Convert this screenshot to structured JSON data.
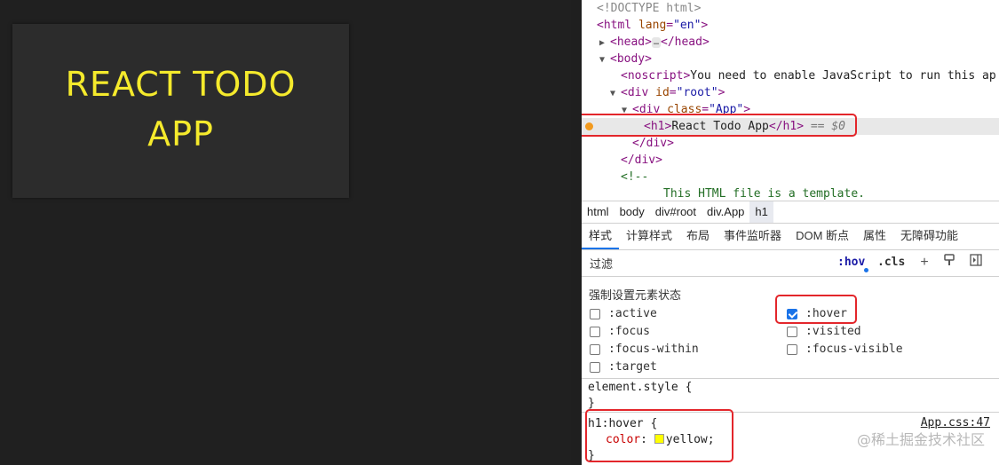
{
  "app": {
    "title": "REACT TODO APP"
  },
  "dom_tree": {
    "doctype": "<!DOCTYPE html>",
    "html_open_tag": "html",
    "html_attr_name": "lang",
    "html_attr_value": "\"en\"",
    "head_tag": "head",
    "head_close": "</head>",
    "body_tag": "body",
    "noscript_tag": "noscript",
    "noscript_text": "You need to enable JavaScript to run this ap",
    "div_root_tag": "div",
    "div_root_attr_name": "id",
    "div_root_attr_value": "\"root\"",
    "div_app_tag": "div",
    "div_app_attr_name": "class",
    "div_app_attr_value": "\"App\"",
    "h1_open": "<h1>",
    "h1_text": "React Todo App",
    "h1_close": "</h1>",
    "selected_marker": "== $0",
    "div_close": "</div>",
    "comment_open": "<!--",
    "comment_text": "This HTML file is a template."
  },
  "breadcrumb": [
    "html",
    "body",
    "div#root",
    "div.App",
    "h1"
  ],
  "tabs": [
    "样式",
    "计算样式",
    "布局",
    "事件监听器",
    "DOM 断点",
    "属性",
    "无障碍功能"
  ],
  "filter": {
    "placeholder": "过滤",
    "hov_label": ":hov",
    "cls_label": ".cls"
  },
  "force_state": {
    "title": "强制设置元素状态",
    "left": [
      ":active",
      ":focus",
      ":focus-within",
      ":target"
    ],
    "right": [
      ":hover",
      ":visited",
      ":focus-visible"
    ],
    "checked": ":hover"
  },
  "styles": {
    "element_style": "element.style {",
    "close_brace": "}",
    "hover_selector": "h1:hover {",
    "hover_prop": "color",
    "hover_value": "yellow",
    "source": "App.css:47"
  },
  "watermark": "@稀土掘金技术社区",
  "colors": {
    "accent": "#1a73e8",
    "highlight_box": "#e3262b",
    "app_text": "#f5ea2c"
  }
}
